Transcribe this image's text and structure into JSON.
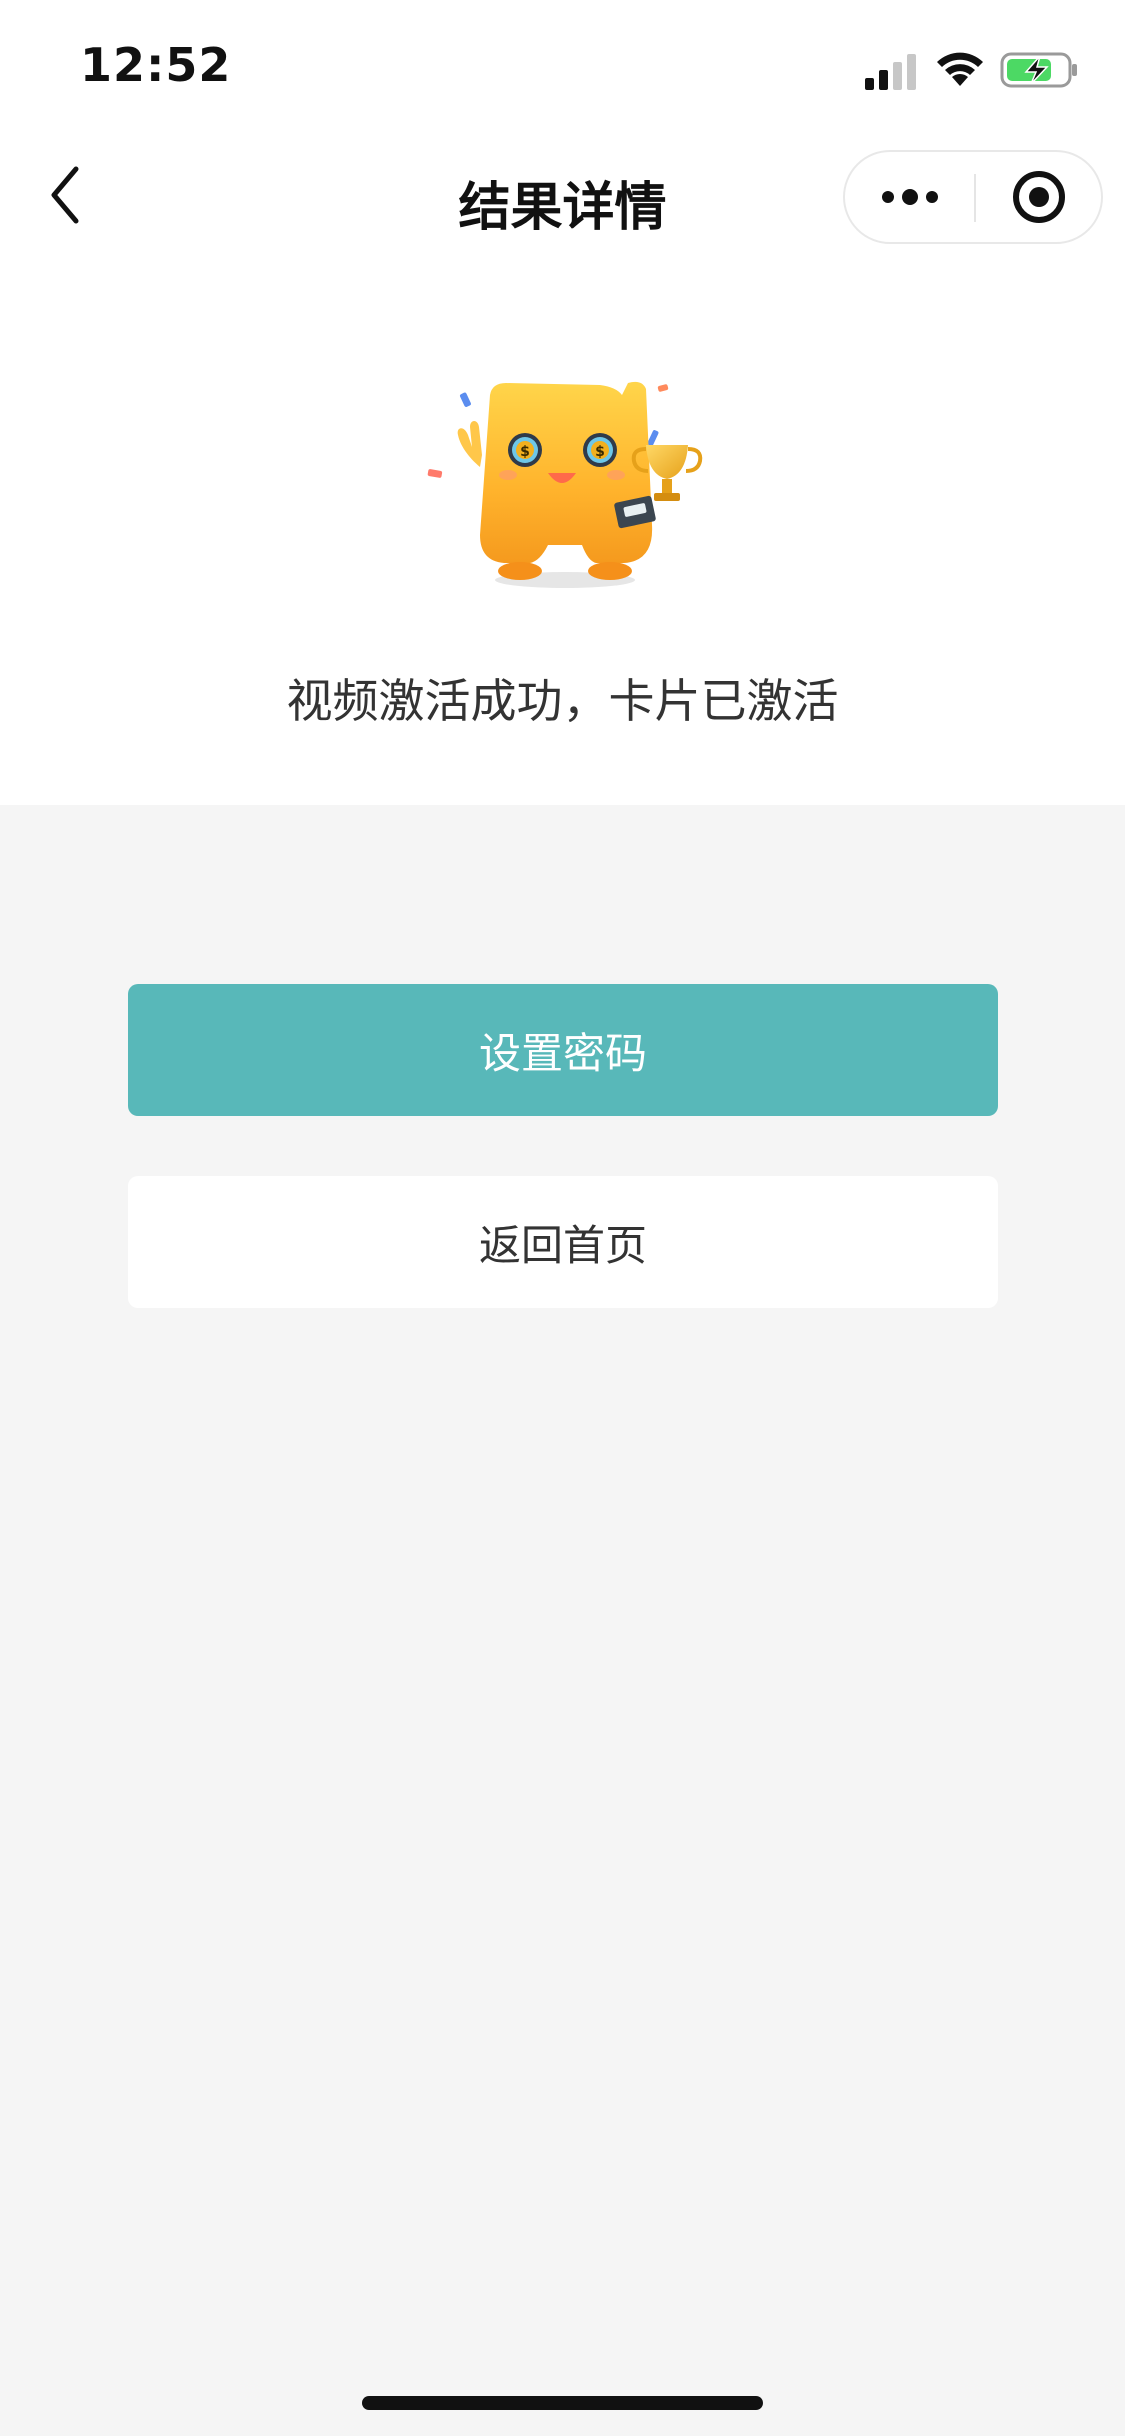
{
  "status_bar": {
    "time": "12:52",
    "signal_icon": "cellular-signal-icon",
    "wifi_icon": "wifi-icon",
    "battery_icon": "battery-charging-icon",
    "battery_color": "#4cd964"
  },
  "nav": {
    "back_icon": "chevron-left-icon",
    "title": "结果详情",
    "more_icon": "more-dots-icon",
    "close_icon": "target-circle-icon"
  },
  "result": {
    "mascot_icon": "mascot-illustration",
    "message": "视频激活成功，卡片已激活"
  },
  "actions": {
    "primary_label": "设置密码",
    "secondary_label": "返回首页",
    "accent_color": "#58b8b9"
  }
}
